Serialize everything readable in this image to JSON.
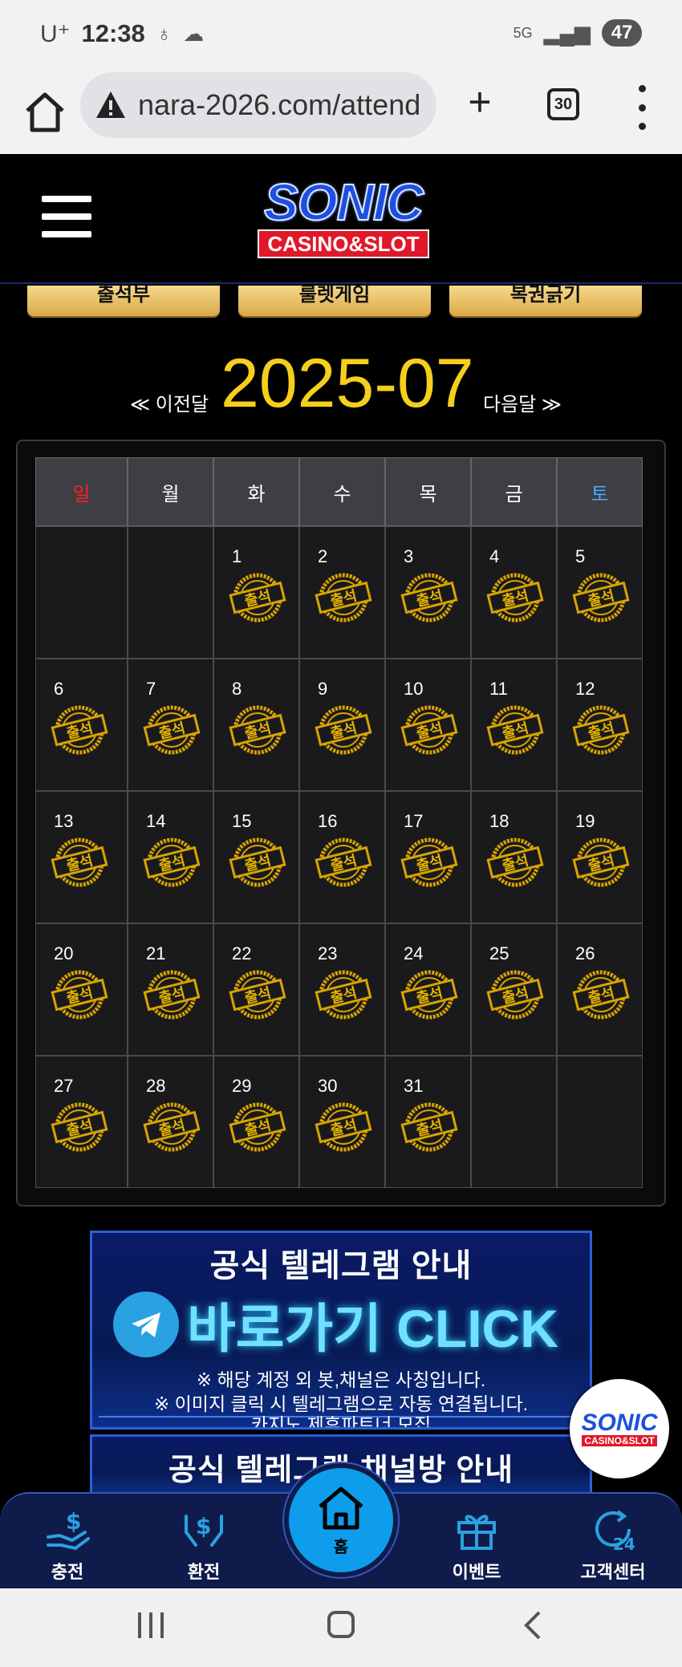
{
  "status_bar": {
    "carrier": "U⁺",
    "time": "12:38",
    "network": "5G",
    "battery": "47"
  },
  "browser": {
    "url": "nara-2026.com/attend",
    "tab_count": "30"
  },
  "site": {
    "logo_main": "SONIC",
    "logo_sub": "CASINO&SLOT"
  },
  "tabs": [
    "출석부",
    "룰렛게임",
    "복권긁기"
  ],
  "month_nav": {
    "prev": "≪ 이전달",
    "current": "2025-07",
    "next": "다음달 ≫"
  },
  "calendar": {
    "weekdays": [
      "일",
      "월",
      "화",
      "수",
      "목",
      "금",
      "토"
    ],
    "stamp_text": "출석",
    "weeks": [
      [
        "",
        "",
        "1",
        "2",
        "3",
        "4",
        "5"
      ],
      [
        "6",
        "7",
        "8",
        "9",
        "10",
        "11",
        "12"
      ],
      [
        "13",
        "14",
        "15",
        "16",
        "17",
        "18",
        "19"
      ],
      [
        "20",
        "21",
        "22",
        "23",
        "24",
        "25",
        "26"
      ],
      [
        "27",
        "28",
        "29",
        "30",
        "31",
        "",
        ""
      ]
    ]
  },
  "banner1": {
    "title": "공식 텔레그램 안내",
    "cta": "바로가기 CLICK",
    "note1": "※ 해당 계정 외 봇,채널은 사칭입니다.",
    "note2": "※ 이미지 클릭 시 텔레그램으로 자동 연결됩니다.",
    "note3": "카지노 제휴파트너 모집"
  },
  "banner2": {
    "title": "공식 텔레그램 채널방 안내"
  },
  "bottom_nav": {
    "deposit": "충전",
    "withdraw": "환전",
    "home": "홈",
    "event": "이벤트",
    "support": "고객센터"
  },
  "colors": {
    "gold": "#f6cf1c",
    "sunday": "#ff2020",
    "saturday": "#4aa8ff",
    "accent_blue": "#0e9dea"
  }
}
